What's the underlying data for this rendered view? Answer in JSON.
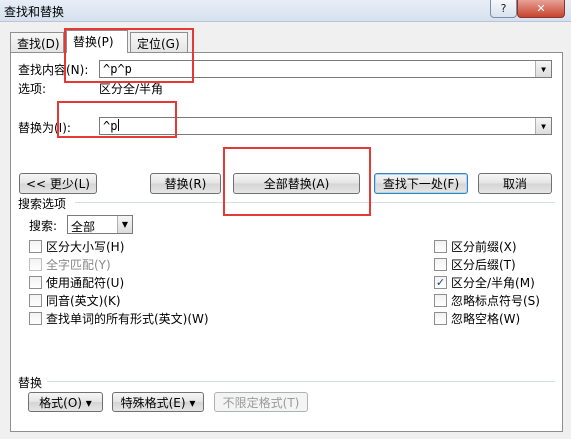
{
  "window": {
    "title": "查找和替换",
    "help_label": "?",
    "close_label": "✕"
  },
  "tabs": [
    {
      "label": "查找(D)",
      "active": false
    },
    {
      "label": "替换(P)",
      "active": true
    },
    {
      "label": "定位(G)",
      "active": false
    }
  ],
  "find": {
    "label": "查找内容(N):",
    "value": "^p^p",
    "options_label": "选项:",
    "options_value": "区分全/半角"
  },
  "replace": {
    "label": "替换为(I):",
    "value": "^p"
  },
  "buttons": {
    "less": "<< 更少(L)",
    "replace": "替换(R)",
    "replace_all": "全部替换(A)",
    "find_next": "查找下一处(F)",
    "cancel": "取消"
  },
  "search_options": {
    "title": "搜索选项",
    "search_label": "搜索:",
    "search_value": "全部",
    "left": [
      {
        "label": "区分大小写(H)",
        "checked": false,
        "disabled": false
      },
      {
        "label": "全字匹配(Y)",
        "checked": false,
        "disabled": true
      },
      {
        "label": "使用通配符(U)",
        "checked": false,
        "disabled": false
      },
      {
        "label": "同音(英文)(K)",
        "checked": false,
        "disabled": false
      },
      {
        "label": "查找单词的所有形式(英文)(W)",
        "checked": false,
        "disabled": false
      }
    ],
    "right": [
      {
        "label": "区分前缀(X)",
        "checked": false,
        "disabled": false
      },
      {
        "label": "区分后缀(T)",
        "checked": false,
        "disabled": false
      },
      {
        "label": "区分全/半角(M)",
        "checked": true,
        "disabled": false
      },
      {
        "label": "忽略标点符号(S)",
        "checked": false,
        "disabled": false
      },
      {
        "label": "忽略空格(W)",
        "checked": false,
        "disabled": false
      }
    ]
  },
  "replace_section": {
    "title": "替换",
    "format": "格式(O) ▾",
    "special": "特殊格式(E) ▾",
    "no_format": "不限定格式(T)"
  },
  "colors": {
    "annotation": "#e53935",
    "active_tab": "#ffffff"
  }
}
